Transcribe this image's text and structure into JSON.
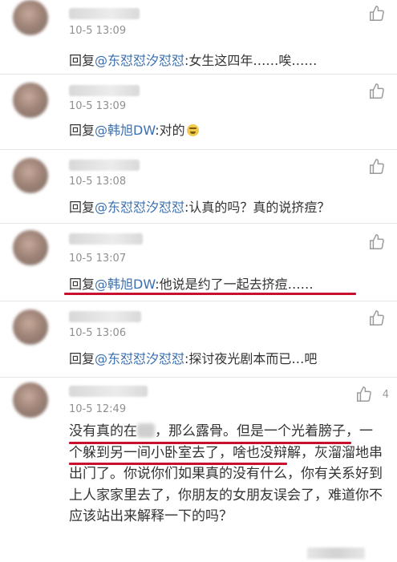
{
  "comments": [
    {
      "time": "10-5 13:09",
      "prefix": "回复",
      "mention": "@东怼怼汐怼怼",
      "text": ":女生这四年……唉……"
    },
    {
      "time": "10-5 13:09",
      "prefix": "回复",
      "mention": "@韩旭DW",
      "text": ":对的"
    },
    {
      "time": "10-5 13:08",
      "prefix": "回复",
      "mention": "@东怼怼汐怼怼",
      "text": ":认真的吗？真的说挤痘？"
    },
    {
      "time": "10-5 13:07",
      "prefix": "回复",
      "mention": "@韩旭DW",
      "text": ":他说是约了一起去挤痘……"
    },
    {
      "time": "10-5 13:06",
      "prefix": "回复",
      "mention": "@东怼怼汐怼怼",
      "text": ":探讨夜光剧本而已…吧"
    }
  ],
  "last_comment": {
    "time": "10-5 12:49",
    "like_count": "4",
    "text_part1": "没有真的在",
    "text_part2": "，那么露骨。但是一个光着膀子，一个躲到另一间小卧室去了，啥也没辩解，灰溜溜地串出门了。你说你们如果真的没有什么，你有关系好到上人家家里去了，你朋友的女朋友误会了，难道你不应该站出来解释一下的吗？"
  },
  "icons": {
    "like": "thumbs-up-icon",
    "emoji": "laughing-emoji-icon"
  },
  "colors": {
    "mention": "#3a6fb0",
    "underline": "#c8102e",
    "text": "#333333",
    "time": "#909090"
  }
}
